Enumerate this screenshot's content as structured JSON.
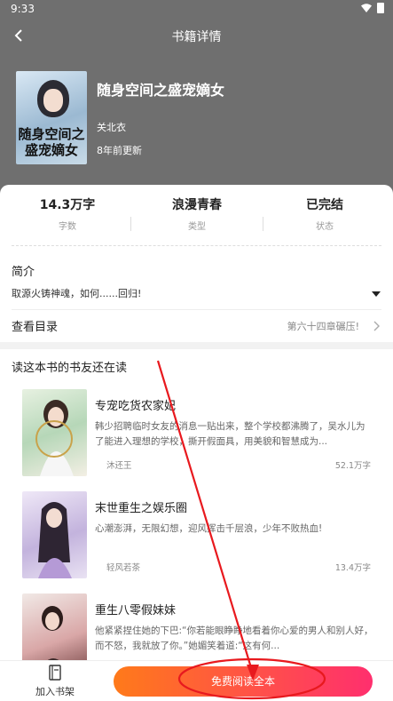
{
  "status_bar": {
    "time": "9:33"
  },
  "nav": {
    "title": "书籍详情"
  },
  "book": {
    "cover_text": "随身空间之盛宠嫡女",
    "title": "随身空间之盛宠嫡女",
    "author": "关北衣",
    "updated": "8年前更新"
  },
  "stats": [
    {
      "value": "14.3万字",
      "label": "字数"
    },
    {
      "value": "浪漫青春",
      "label": "类型"
    },
    {
      "value": "已完结",
      "label": "状态"
    }
  ],
  "intro": {
    "heading": "简介",
    "text": "取源火铸神魂，如何......回归!"
  },
  "toc": {
    "label": "查看目录",
    "latest": "第六十四章碾压!"
  },
  "recommend": {
    "heading": "读这本书的书友还在读",
    "items": [
      {
        "title": "专宠吃货农家妃",
        "desc": "韩少招聘临时女友的消息一贴出来，整个学校都沸腾了，吴水儿为了能进入理想的学校，撕开假面具，用美貌和智慧成为...",
        "author": "沐还王",
        "count": "52.1万字"
      },
      {
        "title": "末世重生之娱乐圈",
        "desc": "心潮澎湃，无限幻想，迎风挥击千层浪，少年不败热血!",
        "author": "轻风若茶",
        "count": "13.4万字"
      },
      {
        "title": "重生八零假妹妹",
        "desc": "他紧紧捏住她的下巴:“你若能眼睁睁地看着你心爱的男人和别人好，而不怒，我就放了你。”她媚笑着道:“这有何...",
        "author": "",
        "count": ""
      }
    ]
  },
  "bottom_bar": {
    "shelf_label": "加入书架",
    "read_label": "免费阅读全本"
  },
  "colors": {
    "header_bg": "#6f6f6f",
    "button_start": "#ff7a1a",
    "button_end": "#ff2f6e",
    "annotation": "#e8191e"
  },
  "icons": [
    "wifi-icon",
    "battery-icon",
    "back-arrow-icon",
    "dropdown-triangle-icon",
    "chevron-right-icon",
    "bookshelf-icon"
  ]
}
